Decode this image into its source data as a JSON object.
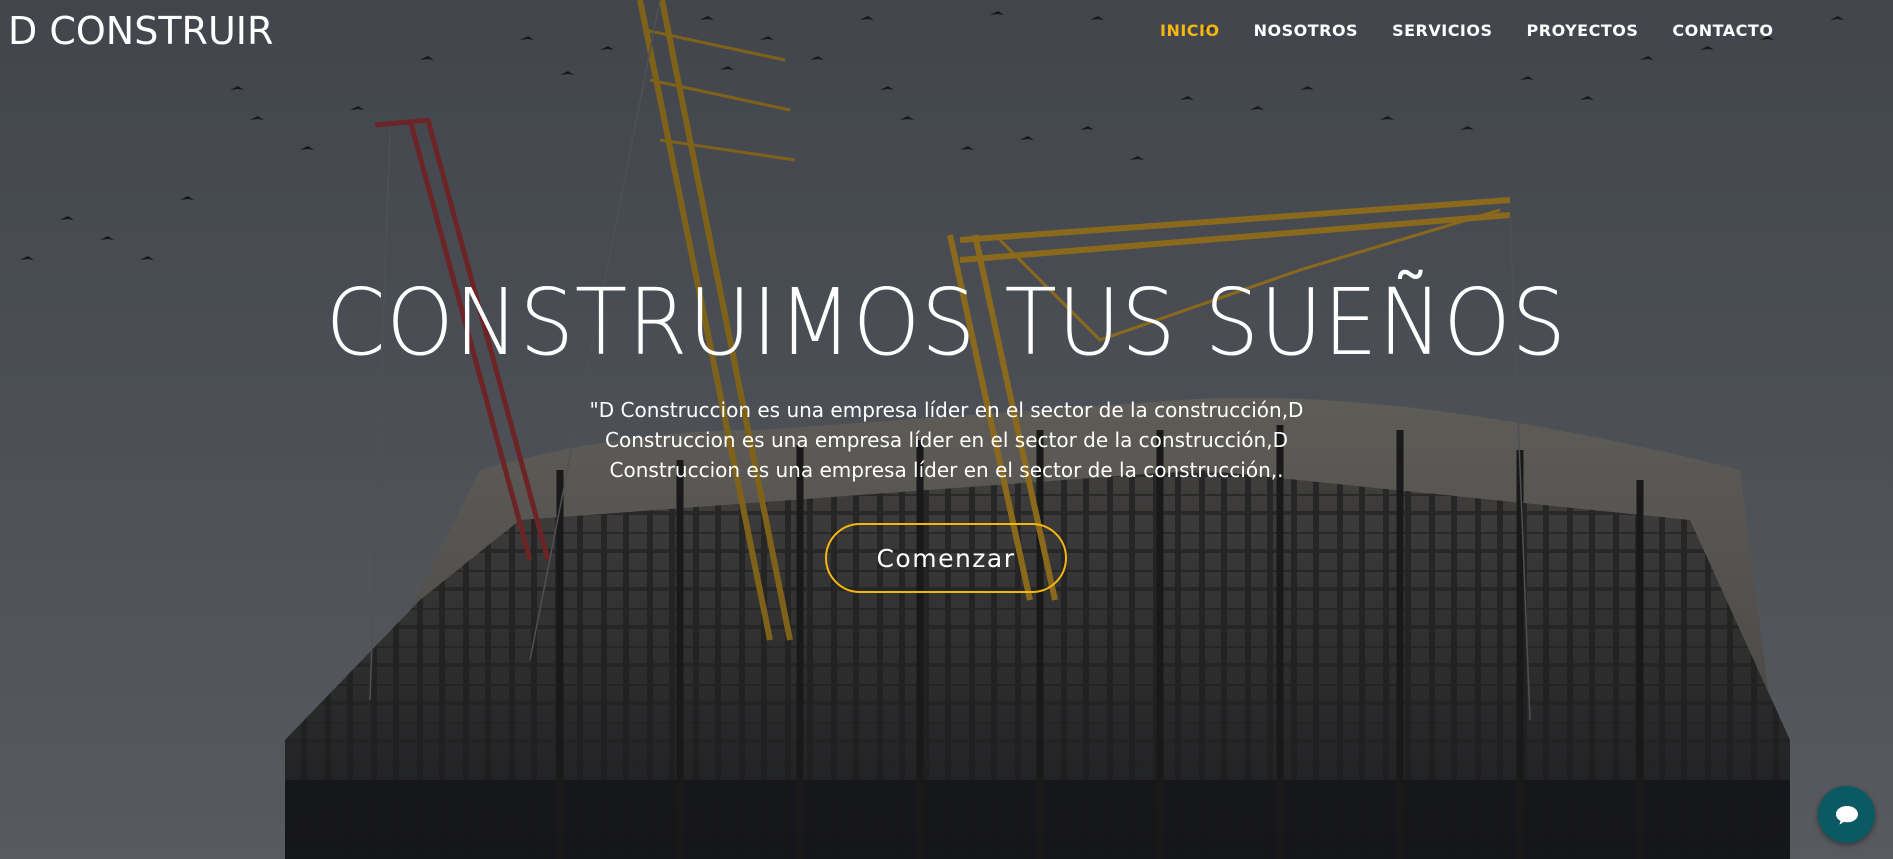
{
  "brand": {
    "logo_text": "D CONSTRUIR"
  },
  "nav": {
    "items": [
      {
        "label": "INICIO",
        "active": true
      },
      {
        "label": "NOSOTROS",
        "active": false
      },
      {
        "label": "SERVICIOS",
        "active": false
      },
      {
        "label": "PROYECTOS",
        "active": false
      },
      {
        "label": "CONTACTO",
        "active": false
      }
    ]
  },
  "hero": {
    "title": "CONSTRUIMOS TUS SUEÑOS",
    "subtitle_lines": [
      "\"D Construccion es una empresa líder en el sector de la construcción,D",
      "Construccion es una empresa líder en el sector de la construcción,D",
      "Construccion es una empresa líder en el sector de la construcción,."
    ],
    "cta_label": "Comenzar",
    "background_image": "construction-site-cranes-photo"
  },
  "chat": {
    "icon": "chat-bubble-icon"
  },
  "colors": {
    "accent": "#f5b70e",
    "text": "#ffffff",
    "chat_bg": "#0b5a63"
  }
}
